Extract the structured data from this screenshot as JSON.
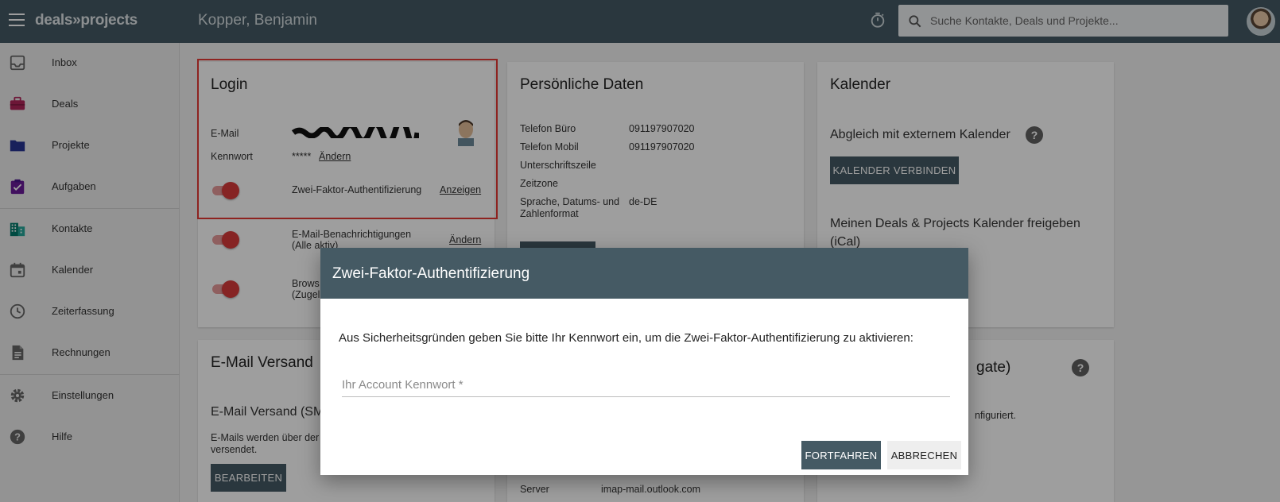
{
  "app": {
    "brand_left": "deals",
    "brand_arrows": "»",
    "brand_right": "projects",
    "page_title": "Kopper, Benjamin"
  },
  "search": {
    "placeholder": "Suche Kontakte, Deals und Projekte..."
  },
  "sidebar": {
    "items": [
      {
        "label": "Inbox",
        "icon": "inbox-icon"
      },
      {
        "label": "Deals",
        "icon": "briefcase-icon"
      },
      {
        "label": "Projekte",
        "icon": "folder-icon"
      },
      {
        "label": "Aufgaben",
        "icon": "task-icon"
      },
      {
        "label": "Kontakte",
        "icon": "building-icon"
      },
      {
        "label": "Kalender",
        "icon": "calendar-icon"
      },
      {
        "label": "Zeiterfassung",
        "icon": "clock-icon"
      },
      {
        "label": "Rechnungen",
        "icon": "document-icon"
      },
      {
        "label": "Einstellungen",
        "icon": "gear-icon"
      },
      {
        "label": "Hilfe",
        "icon": "help-icon"
      }
    ]
  },
  "login": {
    "title": "Login",
    "email_label": "E-Mail",
    "password_label": "Kennwort",
    "password_value": "*****",
    "password_change": "Ändern",
    "twofa_label": "Zwei-Faktor-Authentifizierung",
    "twofa_link": "Anzeigen",
    "notifications_label": "E-Mail-Benachrichtigungen",
    "notifications_sub": "(Alle aktiv)",
    "notifications_link": "Ändern",
    "browser_label": "Brows",
    "browser_sub": "(Zugel"
  },
  "personal": {
    "title": "Persönliche Daten",
    "rows": [
      {
        "label": "Telefon Büro",
        "value": "091197907020"
      },
      {
        "label": "Telefon Mobil",
        "value": "091197907020"
      },
      {
        "label": "Unterschriftszeile",
        "value": ""
      },
      {
        "label": "Zeitzone",
        "value": ""
      },
      {
        "label": "Sprache, Datums- und",
        "value": "de-DE"
      }
    ],
    "row_continuation": "Zahlenformat"
  },
  "calendar": {
    "title": "Kalender",
    "sync_label": "Abgleich mit externem Kalender",
    "connect_button": "KALENDER VERBINDEN",
    "share_label_1": "Meinen Deals & Projects Kalender freigeben",
    "share_label_2": "(iCal)"
  },
  "email_send": {
    "title": "E-Mail Versand",
    "subtitle": "E-Mail Versand (SM",
    "desc_1": "E-Mails werden über der",
    "desc_2": "versendet.",
    "edit_button": "BEARBEITEN"
  },
  "bottom_middle": {
    "server_label": "Server",
    "server_value": "imap-mail.outlook.com"
  },
  "bottom_right": {
    "title_fragment": "gate)",
    "text_fragment": "nfiguriert."
  },
  "dialog": {
    "title": "Zwei-Faktor-Authentifizierung",
    "message": "Aus Sicherheitsgründen geben Sie bitte Ihr Kennwort ein, um die Zwei-Faktor-Authentifizierung zu aktivieren:",
    "password_placeholder": "Ihr Account Kennwort *",
    "continue_button": "FORTFAHREN",
    "cancel_button": "ABBRECHEN"
  },
  "colors": {
    "topbar": "#455a64",
    "toggle_on": "#d93b3b",
    "highlight": "#e53935"
  }
}
